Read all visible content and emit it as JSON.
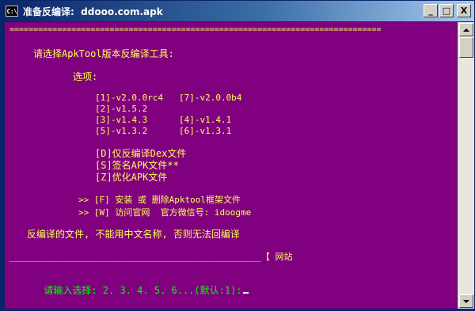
{
  "window": {
    "title": "准备反编译:  ddooo.com.apk",
    "icon_label": "C:\\",
    "buttons": {
      "minimize": "_",
      "maximize": "□",
      "close": "X"
    }
  },
  "console": {
    "separator_top": "==============================================================================",
    "heading": "请选择ApkTool版本反编译工具:",
    "options_label": "选项:",
    "versions": [
      "[1]-v2.0.0rc4   [7]-v2.0.0b4",
      "[2]-v1.5.2",
      "[3]-v1.4.3      [4]-v1.4.1",
      "[5]-v1.3.2      [6]-v1.3.1"
    ],
    "actions": [
      "[D]仅反编译Dex文件",
      "[S]签名APK文件**",
      "[Z]优化APK文件"
    ],
    "extras": [
      ">> [F] 安装 或 删除Apktool框架文件",
      ">> [W] 访问官网  官方微信号: idoogme"
    ],
    "warning": "反编译的文件, 不能用中文名称, 否则无法回编译",
    "bottom_line": "________________________________________________【 网站",
    "prompt": "请输入选择: 2. 3. 4. 5. 6...(默认:1):"
  },
  "colors": {
    "console_bg": "#800080",
    "yellow_text": "#ffff55",
    "green_text": "#00ff00",
    "prompt_text": "#ffffff",
    "titlebar_start": "#0a246a",
    "titlebar_end": "#a6caf0"
  },
  "icons": {
    "app": "console-icon",
    "scroll_up": "arrow-up-icon",
    "scroll_down": "arrow-down-icon"
  }
}
